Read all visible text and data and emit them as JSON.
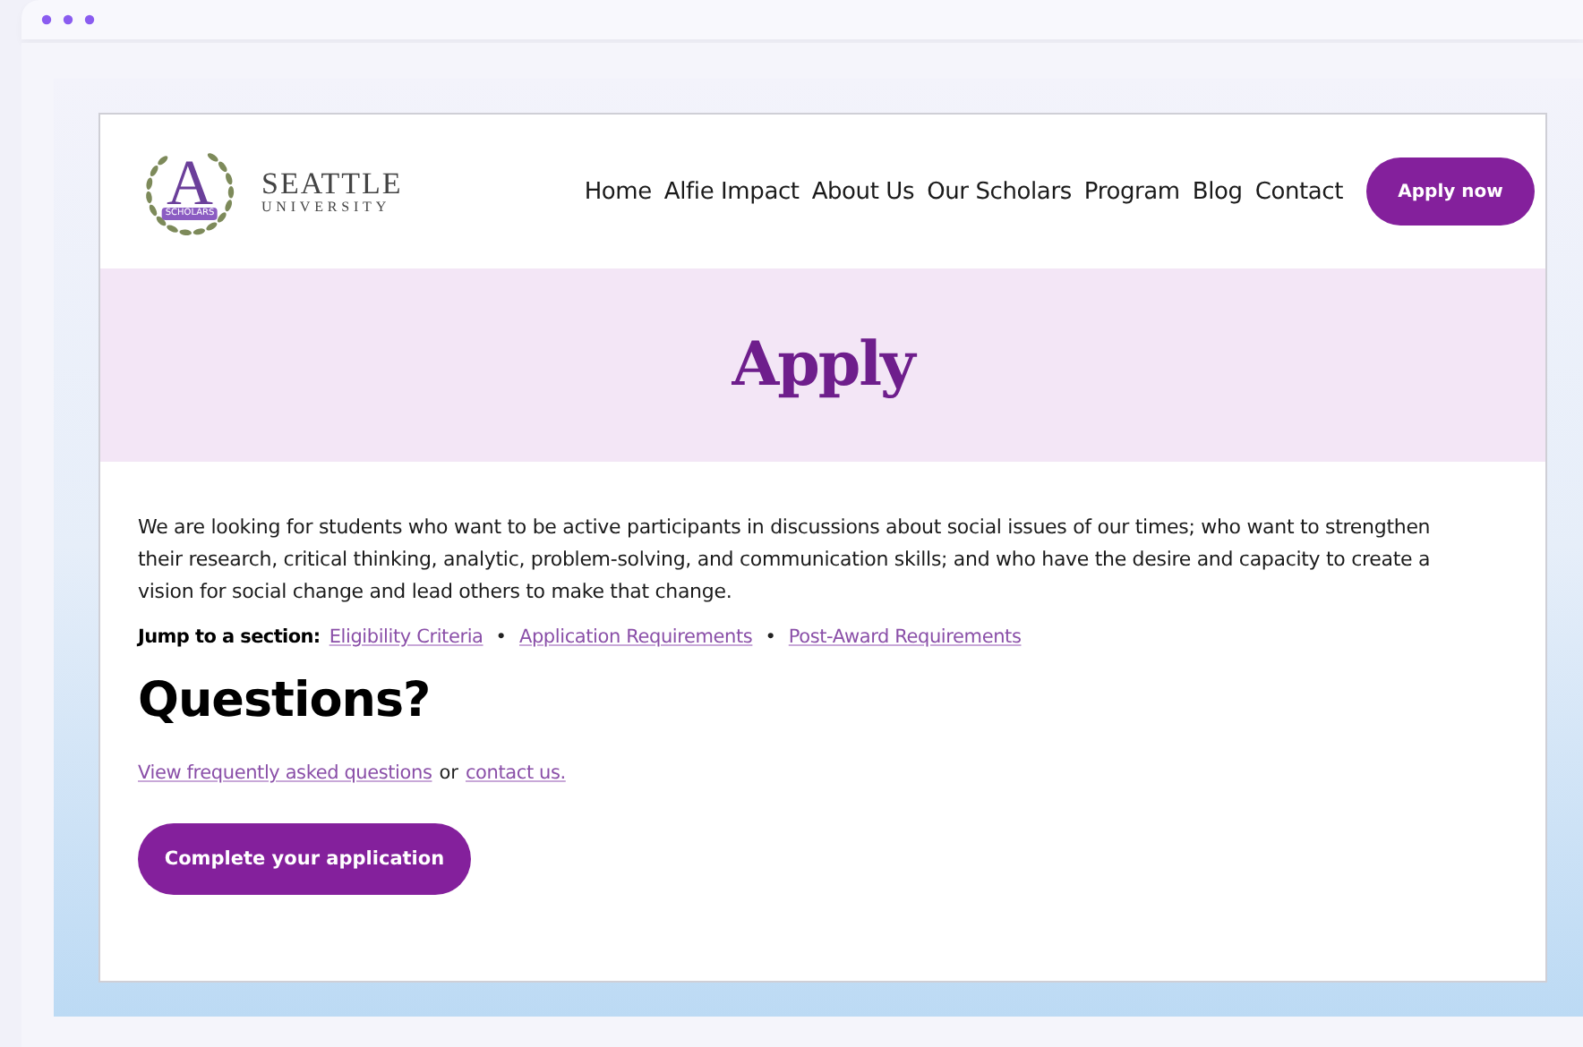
{
  "logo": {
    "letter": "A",
    "ribbon": "SCHOLARS",
    "name": "SEATTLE",
    "subname": "UNIVERSITY"
  },
  "nav": {
    "items": [
      "Home",
      "Alfie Impact",
      "About Us",
      "Our Scholars",
      "Program",
      "Blog",
      "Contact"
    ],
    "cta": "Apply now"
  },
  "hero": {
    "title": "Apply"
  },
  "intro": "We are looking for students who want to be active participants in discussions about social issues of our times; who want to strengthen their research, critical thinking, analytic, problem-solving, and communication skills; and who have the desire and capacity to create a vision for social change and lead others to make that change.",
  "jump": {
    "label": "Jump to a section:",
    "separator": "•",
    "links": [
      "Eligibility Criteria",
      "Application Requirements",
      "Post-Award Requirements"
    ]
  },
  "questions": {
    "title": "Questions?",
    "faq_link": "View frequently asked questions",
    "joiner": "or",
    "contact_link": "contact us.",
    "button": "Complete your application"
  }
}
